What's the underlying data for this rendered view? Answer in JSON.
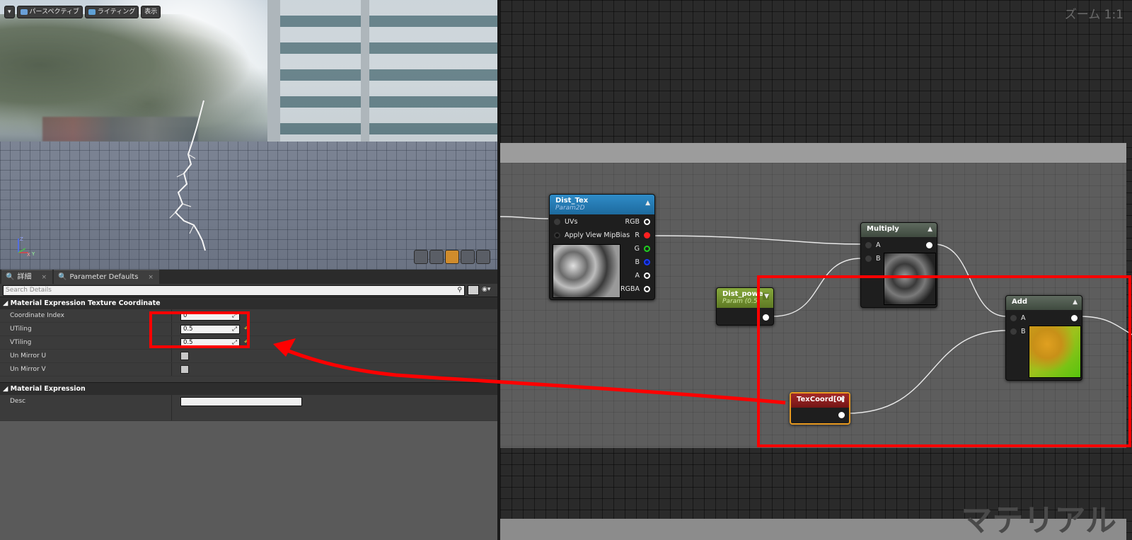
{
  "viewport": {
    "toolbar": {
      "menu_arrow": "▾",
      "perspective_label": "パースペクティブ",
      "lighting_label": "ライティング",
      "show_label": "表示"
    },
    "axis": {
      "z": "Z",
      "x": "X",
      "y": "Y"
    }
  },
  "details": {
    "tabs": [
      {
        "label": "詳細",
        "close": "×"
      },
      {
        "label": "Parameter Defaults",
        "close": "×"
      }
    ],
    "search_placeholder": "Search Details",
    "sections": [
      {
        "title": "Material Expression Texture Coordinate",
        "rows": [
          {
            "name": "Coordinate Index",
            "value": "0"
          },
          {
            "name": "UTiling",
            "value": "0.5"
          },
          {
            "name": "VTiling",
            "value": "0.5"
          },
          {
            "name": "Un Mirror U",
            "value": ""
          },
          {
            "name": "Un Mirror V",
            "value": ""
          }
        ]
      },
      {
        "title": "Material Expression",
        "rows": [
          {
            "name": "Desc",
            "value": ""
          }
        ]
      }
    ],
    "reset_icon": "↶"
  },
  "graph": {
    "zoom_label": "ズーム 1:1",
    "watermark": "マテリアル",
    "nodes": {
      "dist_tex": {
        "title": "Dist_Tex",
        "subtitle": "Param2D",
        "inputs": [
          "UVs",
          "Apply View MipBias"
        ],
        "outputs": [
          "RGB",
          "R",
          "G",
          "B",
          "A",
          "RGBA"
        ]
      },
      "dist_power": {
        "title": "Dist_powe",
        "subtitle": "Param (0.5"
      },
      "multiply": {
        "title": "Multiply",
        "inputs": [
          "A",
          "B"
        ]
      },
      "add": {
        "title": "Add",
        "inputs": [
          "A",
          "B"
        ]
      },
      "texcoord": {
        "title": "TexCoord[0]"
      }
    },
    "colors": {
      "highlight": "#ff0000",
      "texture_node_header": "#1d6a9e",
      "param_node_header": "#6e8a2c",
      "math_node_header": "#3f4a3f",
      "texcoord_node_header": "#8a1c1c"
    }
  }
}
